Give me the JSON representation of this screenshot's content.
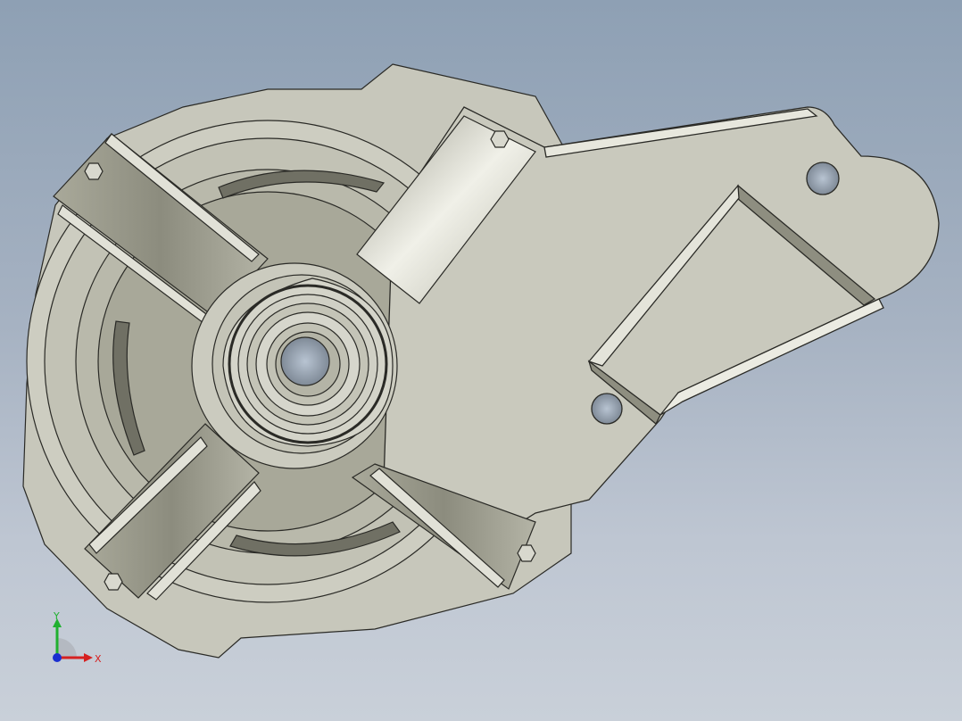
{
  "viewport": {
    "background_top": "#8ea0b4",
    "background_bottom": "#c9d0d9",
    "model_face_color": "#cbcbbf",
    "model_shadow_color": "#8e8e80",
    "edge_color": "#2a2a26"
  },
  "triad": {
    "x_label": "X",
    "y_label": "Y",
    "x_color": "#d62020",
    "y_color": "#20b030",
    "z_color": "#1a2fd0"
  }
}
